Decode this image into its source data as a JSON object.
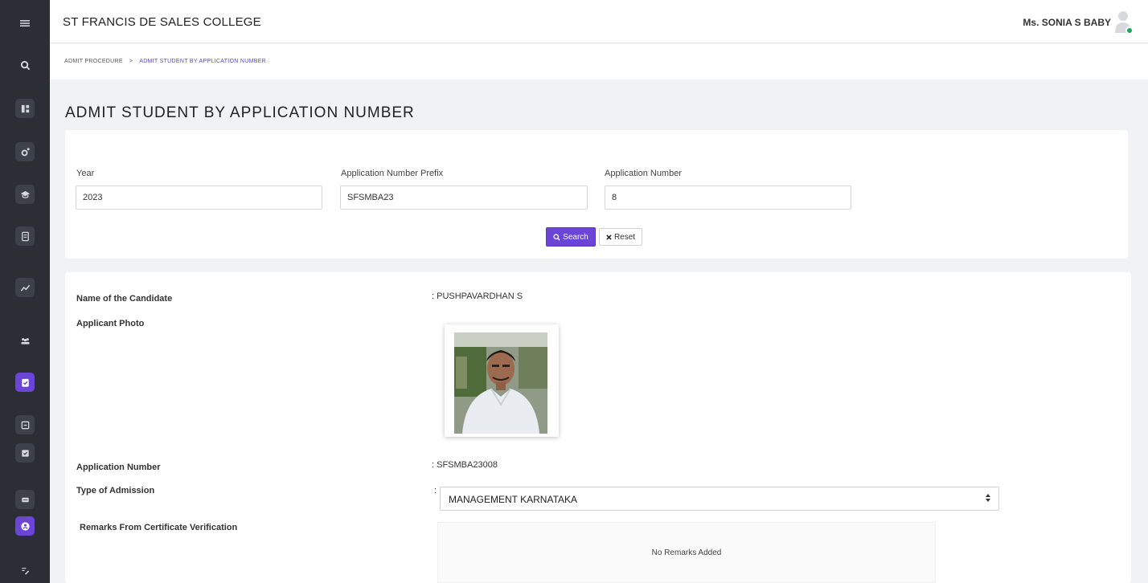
{
  "header": {
    "college_name": "ST FRANCIS DE SALES COLLEGE",
    "user_name": "Ms. SONIA S BABY"
  },
  "breadcrumb": {
    "parent": "ADMIT PROCEDURE",
    "separator": ">",
    "current": "ADMIT STUDENT BY APPLICATION NUMBER"
  },
  "page": {
    "title": "ADMIT STUDENT BY APPLICATION NUMBER"
  },
  "search": {
    "year_label": "Year",
    "year_value": "2023",
    "prefix_label": "Application Number Prefix",
    "prefix_value": "SFSMBA23",
    "number_label": "Application Number",
    "number_value": "8",
    "search_button": "Search",
    "reset_button": "Reset"
  },
  "details": {
    "name_label": "Name of the Candidate",
    "name_value": ": PUSHPAVARDHAN S",
    "photo_label": "Applicant Photo",
    "app_number_label": "Application Number",
    "app_number_value": ": SFSMBA23008",
    "admission_type_label": "Type of Admission",
    "admission_type_colon": ":",
    "admission_type_value": "MANAGEMENT KARNATAKA",
    "remarks_label": "Remarks From Certificate Verification",
    "remarks_value": "No Remarks Added"
  },
  "sidebar": {
    "icons": [
      "menu-icon",
      "search-icon",
      "dashboard-icon",
      "settings-icon",
      "graduation-cap-icon",
      "document-icon",
      "analytics-icon",
      "users-icon",
      "admission-icon",
      "form-icon",
      "checkbox-icon",
      "list-icon",
      "student-icon",
      "edit-icon"
    ]
  },
  "colors": {
    "accent": "#6a45d8",
    "sidebar_bg": "#2b2e35",
    "online": "#1aa658"
  }
}
